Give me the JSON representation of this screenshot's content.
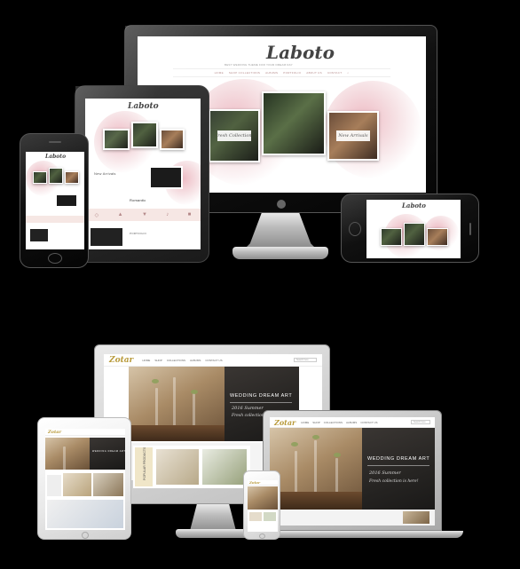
{
  "top_showcase": {
    "brand": "Laboto",
    "tagline": "BEST WEDDING THEME FOR YOUR DREAM DAY",
    "nav_items": [
      "HOME",
      "SHOP COLLECTIONS",
      "ALBUMS",
      "PORTFOLIO",
      "ABOUT US",
      "CONTACT"
    ],
    "card_labels": [
      "Fresh Collections",
      "New Arrivals",
      "Romantic"
    ],
    "colors": {
      "accent": "#b58a8a",
      "floral": "#ecb4be"
    }
  },
  "bottom_showcase": {
    "brand": "Zotar",
    "nav_items": [
      "HOME",
      "SHOP",
      "COLLECTIONS",
      "ALBUMS",
      "CONTACT US"
    ],
    "search_placeholder": "Search here",
    "hero_title": "WEDDING DREAM ART",
    "hero_subtitle": "2016 Summer",
    "hero_tagline": "Fresh collection is here!",
    "side_label": "POPULAR PRODUCTS",
    "colors": {
      "accent": "#b89a3a",
      "hero_dark": "#262422"
    }
  }
}
